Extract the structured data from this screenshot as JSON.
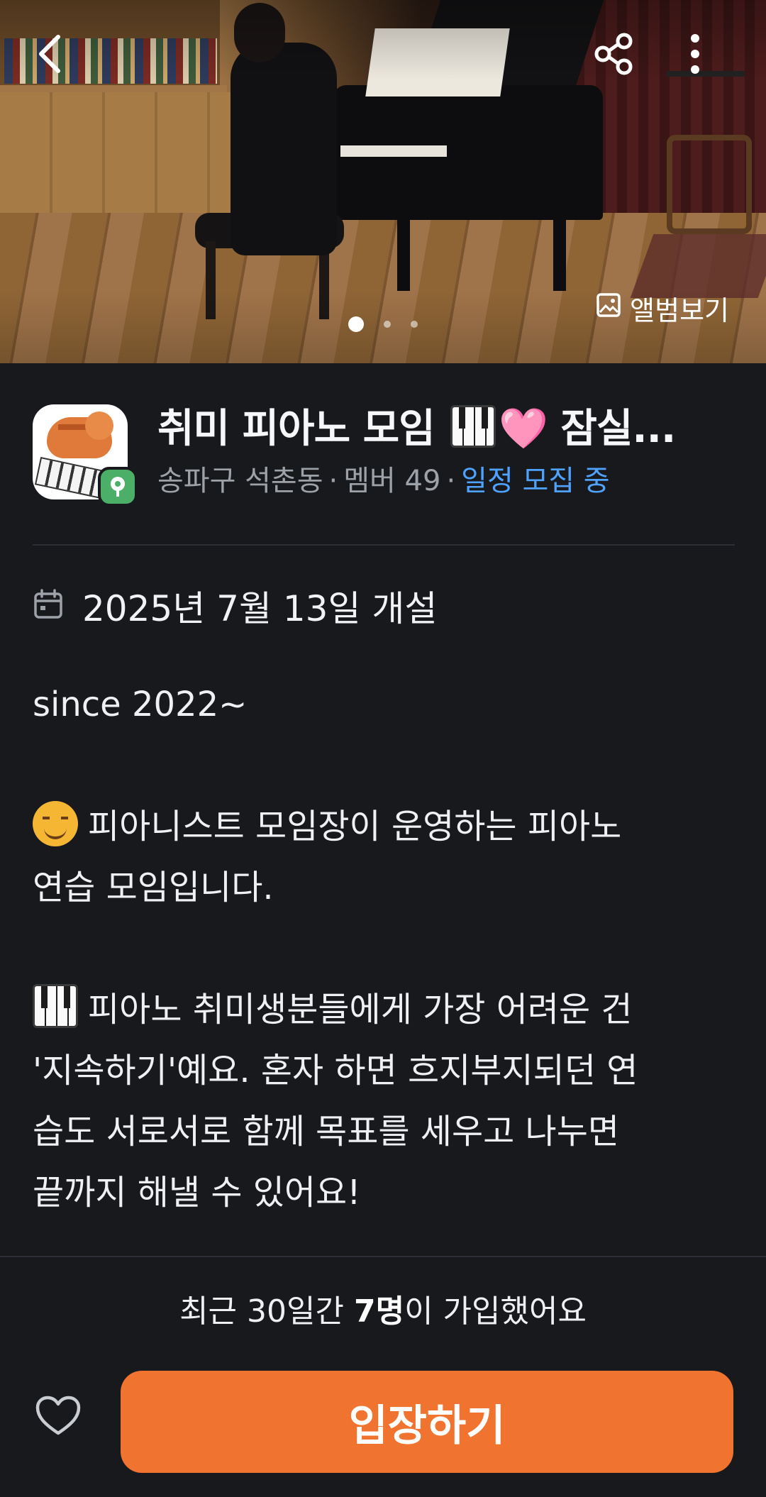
{
  "hero": {
    "album_label": "앨범보기",
    "slide_count": 3,
    "active_slide": 1,
    "icons": {
      "back": "chevron-left-icon",
      "share": "share-icon",
      "more": "more-vertical-icon",
      "album": "image-icon"
    }
  },
  "group": {
    "title_part1": "취미 피아노 모임 ",
    "title_heart": "🩷",
    "title_part2": " 잠실...",
    "location": "송파구 석촌동",
    "separator": "·",
    "members": "멤버 49",
    "status": "일정 모집 중",
    "status_color": "#4fa3ff"
  },
  "details": {
    "founded": "2025년 7월 13일 개설",
    "founded_icon": "calendar-icon",
    "desc_since": "since 2022~",
    "desc_p2_line1": "피아니스트 모임장이 운영하는 피아노",
    "desc_p2_line2": "연습 모임입니다.",
    "desc_p3_line1": "피아노 취미생분들에게 가장 어려운 건",
    "desc_p3_line2": "'지속하기'예요. 혼자 하면 흐지부지되던 연",
    "desc_p3_line3": "습도 서로서로 함께 목표를 세우고 나누면",
    "desc_p3_line4": "끝까지 해낼 수 있어요!"
  },
  "bottom": {
    "joined_prefix": "최근 30일간 ",
    "joined_count": "7명",
    "joined_suffix": "이 가입했어요",
    "enter_label": "입장하기",
    "accent": "#f0742f",
    "like_icon": "heart-outline-icon"
  }
}
